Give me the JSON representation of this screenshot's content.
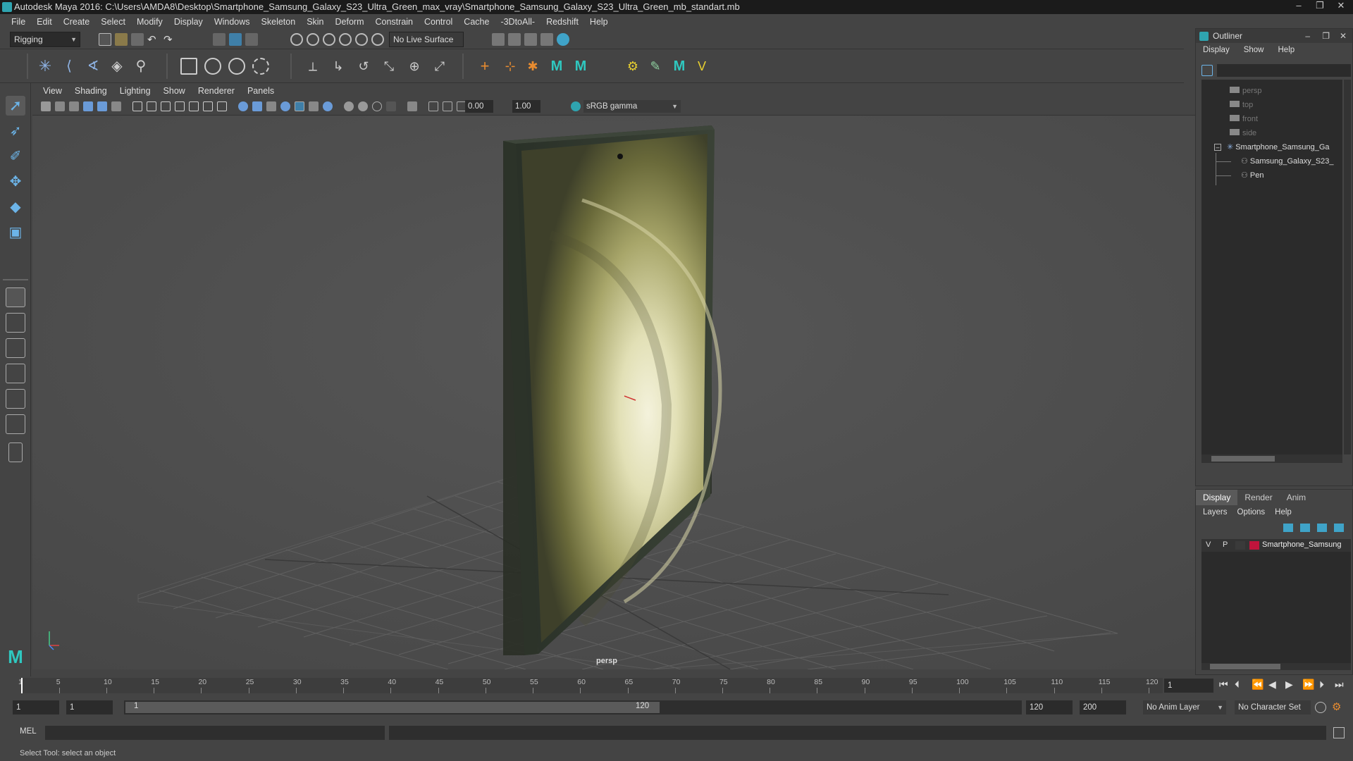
{
  "window": {
    "title": "Autodesk Maya 2016: C:\\Users\\AMDA8\\Desktop\\Smartphone_Samsung_Galaxy_S23_Ultra_Green_max_vray\\Smartphone_Samsung_Galaxy_S23_Ultra_Green_mb_standart.mb",
    "minimize": "–",
    "maximize": "❐",
    "close": "✕"
  },
  "menubar": [
    "File",
    "Edit",
    "Create",
    "Select",
    "Modify",
    "Display",
    "Windows",
    "Skeleton",
    "Skin",
    "Deform",
    "Constrain",
    "Control",
    "Cache",
    "-3DtoAll-",
    "Redshift",
    "Help"
  ],
  "statusline": {
    "mode": "Rigging",
    "live_surface": "No Live Surface"
  },
  "panel_menu": [
    "View",
    "Shading",
    "Lighting",
    "Show",
    "Renderer",
    "Panels"
  ],
  "panel_toolbar": {
    "exposure": "0.00",
    "gamma": "1.00",
    "color_space": "sRGB gamma"
  },
  "viewport": {
    "camera_label": "persp"
  },
  "outliner": {
    "title": "Outliner",
    "menu": [
      "Display",
      "Show",
      "Help"
    ],
    "items": [
      {
        "label": "persp"
      },
      {
        "label": "top"
      },
      {
        "label": "front"
      },
      {
        "label": "side"
      },
      {
        "label": "Smartphone_Samsung_Ga"
      },
      {
        "label": "Samsung_Galaxy_S23_"
      },
      {
        "label": "Pen"
      }
    ]
  },
  "layer_panel": {
    "tabs": [
      "Display",
      "Render",
      "Anim"
    ],
    "menu": [
      "Layers",
      "Options",
      "Help"
    ],
    "layer": {
      "v": "V",
      "p": "P",
      "name": "Smartphone_Samsung",
      "color": "#c0143c"
    }
  },
  "timeline": {
    "ticks": [
      "1",
      "5",
      "10",
      "15",
      "20",
      "25",
      "30",
      "35",
      "40",
      "45",
      "50",
      "55",
      "60",
      "65",
      "70",
      "75",
      "80",
      "85",
      "90",
      "95",
      "100",
      "105",
      "110",
      "115",
      "120"
    ],
    "current_frame": "1"
  },
  "range": {
    "start": "1",
    "playback_start": "1",
    "slider_start": "1",
    "slider_end": "120",
    "playback_end": "120",
    "end": "200",
    "anim_layer": "No Anim Layer",
    "character_set": "No Character Set"
  },
  "mel": {
    "label": "MEL"
  },
  "help_line": "Select Tool: select an object",
  "colors": {
    "accent": "#2fa4b0",
    "layer_swatch": "#c0143c"
  }
}
